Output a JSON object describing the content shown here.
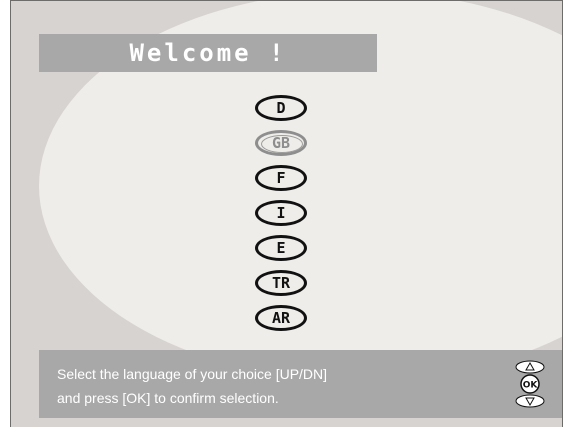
{
  "title": "Welcome !",
  "languages": [
    {
      "code": "D",
      "state": "normal"
    },
    {
      "code": "GB",
      "state": "selected"
    },
    {
      "code": "F",
      "state": "normal"
    },
    {
      "code": "I",
      "state": "normal"
    },
    {
      "code": "E",
      "state": "normal"
    },
    {
      "code": "TR",
      "state": "normal"
    },
    {
      "code": "AR",
      "state": "normal"
    }
  ],
  "instructions": {
    "line1": "Select the language of your choice [UP/DN]",
    "line2": "and press [OK] to confirm selection."
  },
  "remote": {
    "ok_label": "OK",
    "up_icon": "up-arrow-icon",
    "down_icon": "down-arrow-icon"
  },
  "colors": {
    "background": "#d6d3d0",
    "panel": "#a8a8a8",
    "selected": "#8e8e8e",
    "ink": "#111111"
  }
}
